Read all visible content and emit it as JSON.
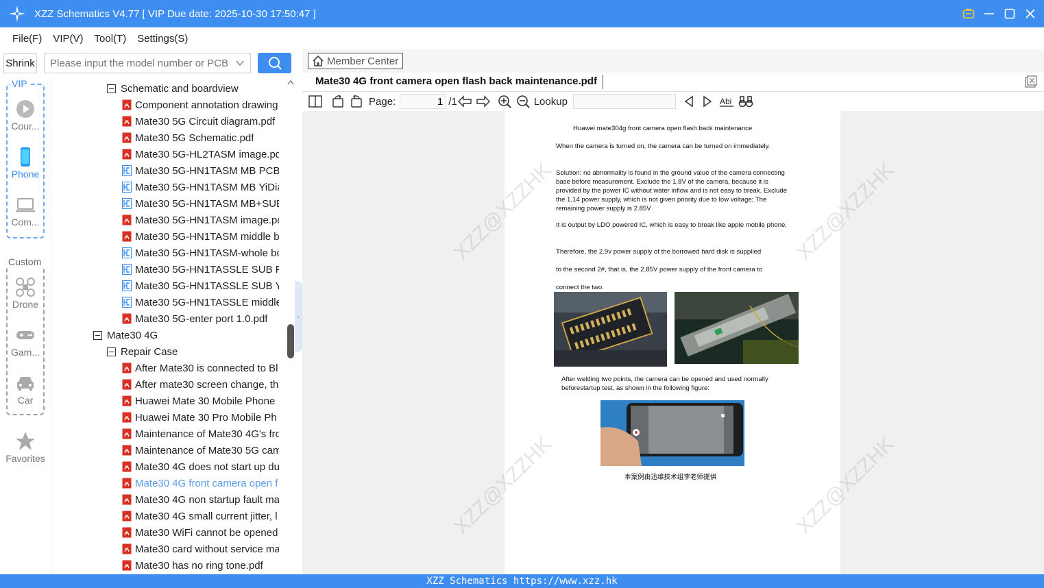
{
  "window": {
    "title": "XZZ Schematics V4.77 [ VIP Due date: 2025-10-30 17:50:47 ]"
  },
  "menu": [
    "File(F)",
    "VIP(V)",
    "Tool(T)",
    "Settings(S)"
  ],
  "search": {
    "shrink_label": "Shrink",
    "placeholder": "Please input the model number or PCB"
  },
  "categories": {
    "vip_label": "VIP",
    "custom_label": "Custom",
    "items": [
      {
        "label": "Cour...",
        "icon": "play-icon"
      },
      {
        "label": "Phone",
        "icon": "phone-icon"
      },
      {
        "label": "Com...",
        "icon": "laptop-icon"
      },
      {
        "label": "Drone",
        "icon": "drone-icon"
      },
      {
        "label": "Gam...",
        "icon": "gamepad-icon"
      },
      {
        "label": "Car",
        "icon": "car-icon"
      },
      {
        "label": "Favorites",
        "icon": "star-icon"
      }
    ]
  },
  "tree": {
    "group1": "Schematic and boardview",
    "group1_files": [
      {
        "name": "Component annotation drawing",
        "type": "pdf"
      },
      {
        "name": "Mate30 5G Circuit diagram.pdf",
        "type": "pdf"
      },
      {
        "name": "Mate30 5G Schematic.pdf",
        "type": "pdf"
      },
      {
        "name": "Mate30 5G-HL2TASM image.pdf",
        "type": "pdf"
      },
      {
        "name": "Mate30 5G-HN1TASM MB PCB",
        "type": "pcb"
      },
      {
        "name": "Mate30 5G-HN1TASM MB YiDian",
        "type": "pcb"
      },
      {
        "name": "Mate30 5G-HN1TASM MB+SUB",
        "type": "pcb"
      },
      {
        "name": "Mate30 5G-HN1TASM image.pdf",
        "type": "pdf"
      },
      {
        "name": "Mate30 5G-HN1TASM middle b",
        "type": "pdf"
      },
      {
        "name": "Mate30 5G-HN1TASM-whole bo",
        "type": "pcb"
      },
      {
        "name": "Mate30 5G-HN1TASSLE SUB PCB",
        "type": "pcb"
      },
      {
        "name": "Mate30 5G-HN1TASSLE SUB YiD",
        "type": "pcb"
      },
      {
        "name": "Mate30 5G-HN1TASSLE middle",
        "type": "pcb"
      },
      {
        "name": "Mate30 5G-enter port 1.0.pdf",
        "type": "pdf"
      }
    ],
    "model2": "Mate30 4G",
    "group2": "Repair Case",
    "group2_files": [
      {
        "name": "After Mate30 is connected to Bl",
        "type": "pdf"
      },
      {
        "name": "After mate30 screen change, the",
        "type": "pdf"
      },
      {
        "name": "Huawei Mate 30 Mobile Phone",
        "type": "pdf"
      },
      {
        "name": "Huawei Mate 30 Pro Mobile Ph",
        "type": "pdf"
      },
      {
        "name": "Maintenance of Mate30 4G's fro",
        "type": "pdf"
      },
      {
        "name": "Maintenance of Mate30 5G cam",
        "type": "pdf"
      },
      {
        "name": "Mate30 4G does not start up du",
        "type": "pdf"
      },
      {
        "name": "Mate30 4G front camera open f",
        "type": "pdf",
        "selected": true
      },
      {
        "name": "Mate30 4G non startup fault ma",
        "type": "pdf"
      },
      {
        "name": "Mate30 4G small current jitter, l",
        "type": "pdf"
      },
      {
        "name": "Mate30 WiFi cannot be opened",
        "type": "pdf"
      },
      {
        "name": "Mate30 card without service ma",
        "type": "pdf"
      },
      {
        "name": "Mate30 has no ring tone.pdf",
        "type": "pdf"
      }
    ]
  },
  "viewer": {
    "member_center": "Member Center",
    "doc_title": "Mate30 4G front camera open flash back maintenance.pdf",
    "page_label": "Page:",
    "page_value": "1",
    "page_total": "/1",
    "lookup_label": "Lookup"
  },
  "document": {
    "heading": "Huawei mate304g front camera open flash back maintenance",
    "p1": "When the camera is turned on, the camera can be turned on immediately.",
    "p2": "Solution: no abnormality is found in the ground value of the camera connecting base before measurement. Exclude the 1.8V of the camera, because it is provided by the power IC without water inflow and is not easy to break. Exclude the 1.14 power supply, which is not given priority due to low voltage; The remaining power supply is 2.85V",
    "p3": "It is output by LDO powered IC, which is easy to break like apple mobile phone.",
    "p4": "Therefore, the 2.9v power supply of the borrowed hard disk is supplied",
    "p5": "to the second 2#, that is, the 2.85V power supply of the front camera to",
    "p6": "connect the two.",
    "p7": "After welding two points, the camera can be opened and used normally beforestartup test, as shown in the following figure:",
    "credit": "本案例由迅维技术组李老师提供",
    "watermark": "XZZ@XZZHK"
  },
  "status": {
    "text": "XZZ Schematics https://www.xzz.hk"
  },
  "colors": {
    "accent": "#3d8ef0",
    "pdf_icon": "#d93025",
    "selected_text": "#5a9cf0"
  }
}
